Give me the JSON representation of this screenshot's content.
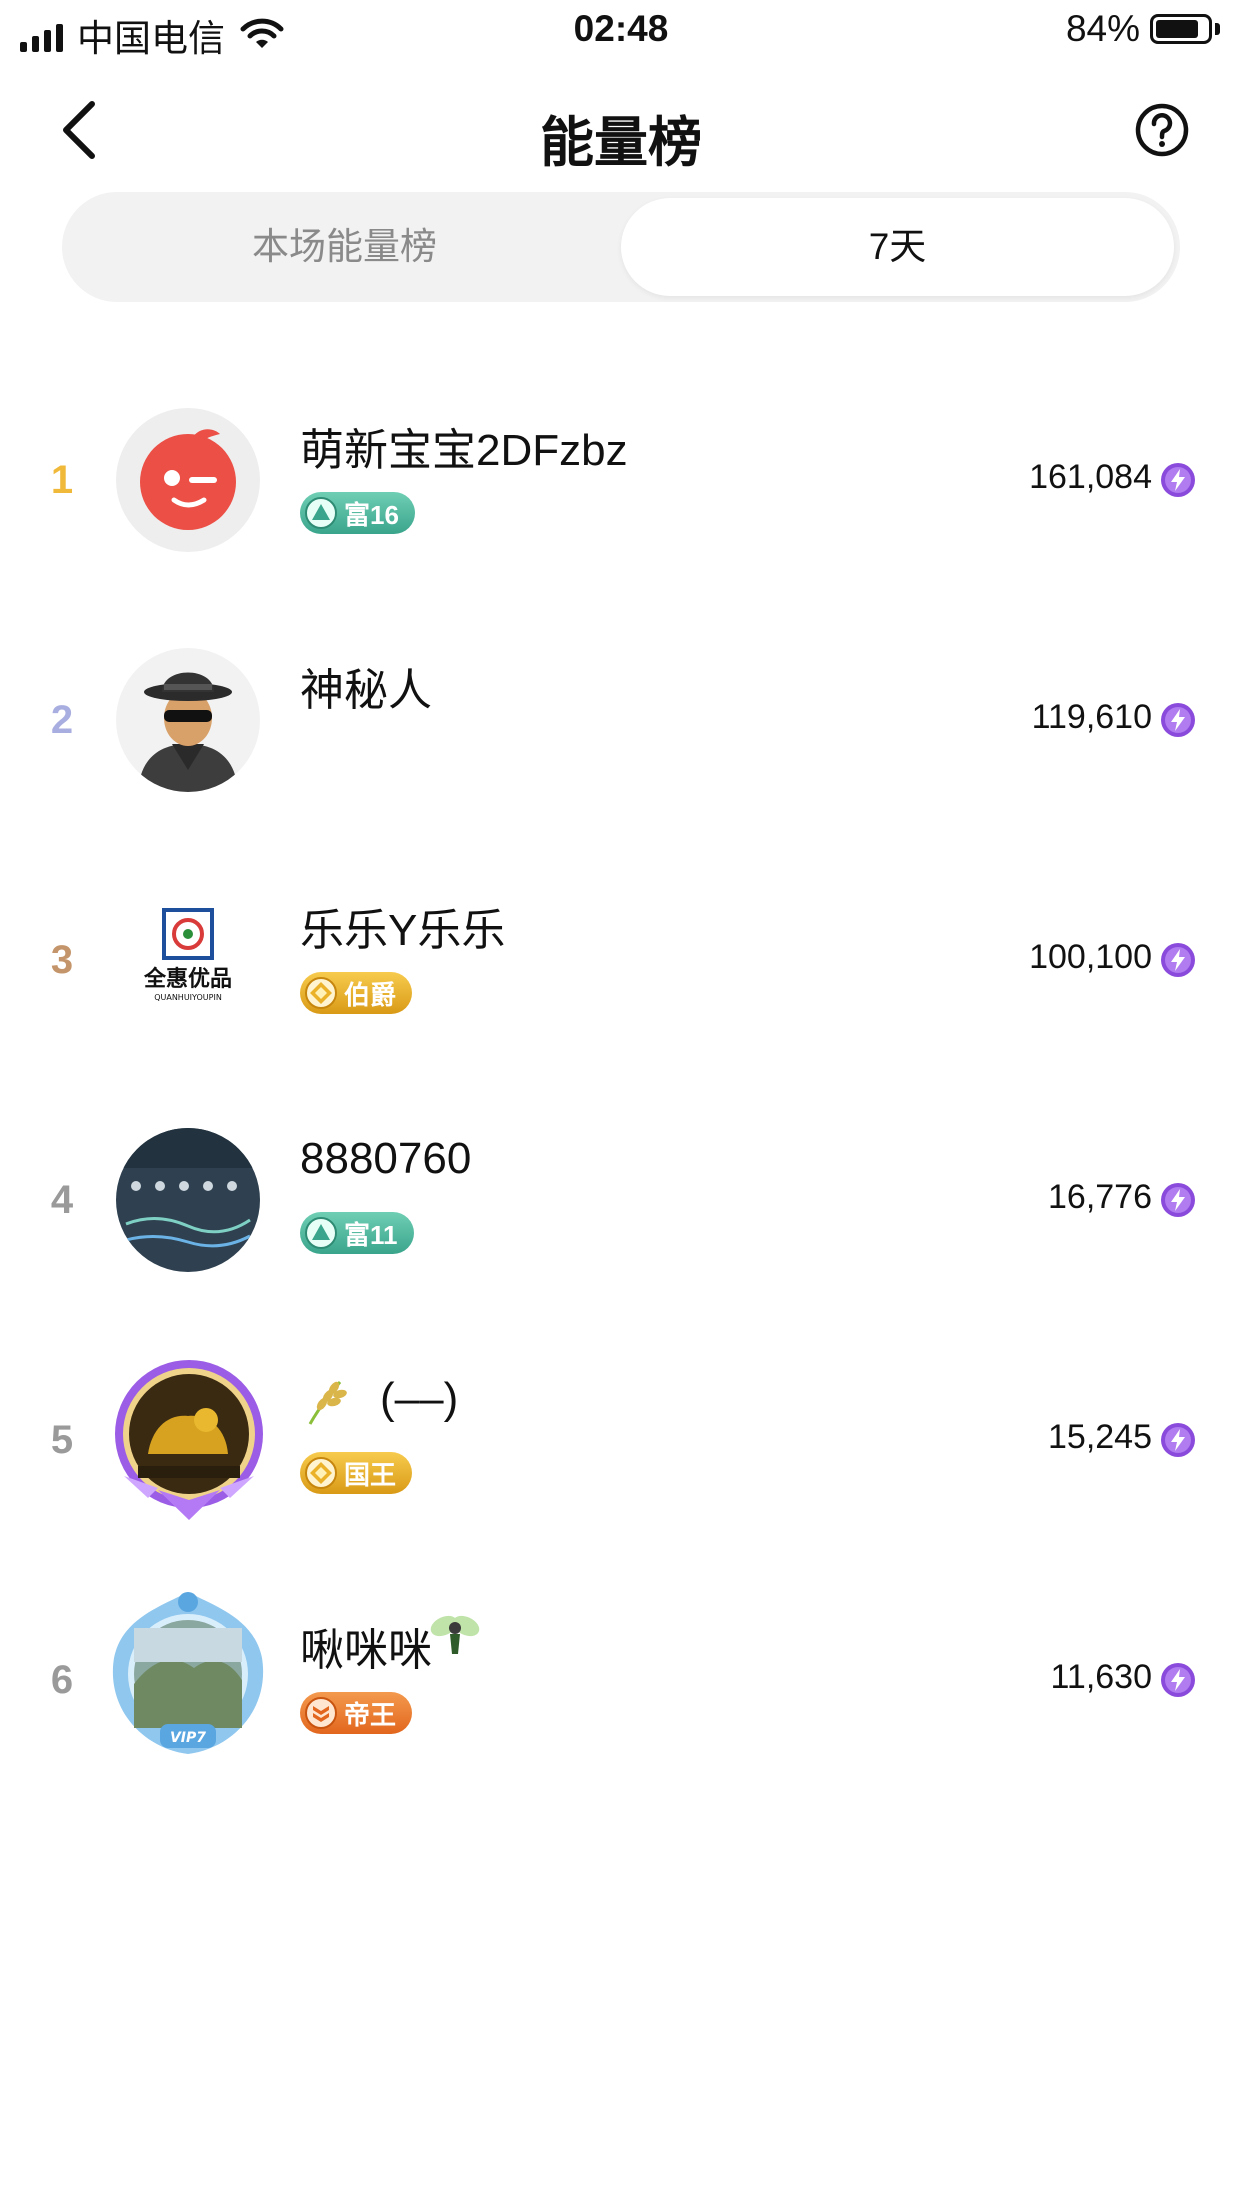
{
  "status_bar": {
    "carrier": "中国电信",
    "time": "02:48",
    "battery": "84%",
    "battery_level": 0.84
  },
  "nav": {
    "title": "能量榜"
  },
  "tabs": [
    {
      "label": "本场能量榜",
      "selected": false
    },
    {
      "label": "7天",
      "selected": true
    }
  ],
  "ranking": [
    {
      "rank": "1",
      "name": "萌新宝宝2DFzbz",
      "badge": "富16",
      "score": "161,084",
      "rank_color": "#f0b93a"
    },
    {
      "rank": "2",
      "name": "神秘人",
      "badge": "",
      "score": "119,610",
      "rank_color": "#a9aee0"
    },
    {
      "rank": "3",
      "name": "乐乐Y乐乐",
      "badge": "伯爵",
      "score": "100,100",
      "rank_color": "#c4956a",
      "avatar_text": "全惠优品",
      "avatar_subtext": "QUANHUIYOUPIN"
    },
    {
      "rank": "4",
      "name": "8880760",
      "badge": "富11",
      "score": "16,776",
      "rank_color": "#9a9a9a"
    },
    {
      "rank": "5",
      "name": "(––)",
      "badge": "国王",
      "score": "15,245",
      "rank_color": "#9a9a9a"
    },
    {
      "rank": "6",
      "name": "啾咪咪",
      "badge": "帝王",
      "score": "11,630",
      "rank_color": "#9a9a9a",
      "avatar_text": "VIP7"
    }
  ],
  "icons": {
    "back": "chevron-left-icon",
    "help": "question-circle-icon",
    "energy": "lightning-bolt-icon"
  },
  "colors": {
    "accent_purple": "#8a4bdc",
    "tab_bg": "#f2f2f2"
  }
}
